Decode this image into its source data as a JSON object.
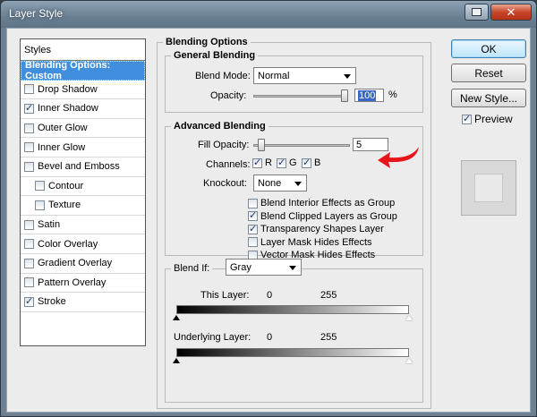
{
  "window": {
    "title": "Layer Style"
  },
  "styles_panel": {
    "header": "Styles",
    "items": [
      {
        "label": "Blending Options: Custom",
        "checkbox": false,
        "checked": false,
        "active": true,
        "indent": false
      },
      {
        "label": "Drop Shadow",
        "checkbox": true,
        "checked": false,
        "active": false,
        "indent": false
      },
      {
        "label": "Inner Shadow",
        "checkbox": true,
        "checked": true,
        "active": false,
        "indent": false
      },
      {
        "label": "Outer Glow",
        "checkbox": true,
        "checked": false,
        "active": false,
        "indent": false
      },
      {
        "label": "Inner Glow",
        "checkbox": true,
        "checked": false,
        "active": false,
        "indent": false
      },
      {
        "label": "Bevel and Emboss",
        "checkbox": true,
        "checked": false,
        "active": false,
        "indent": false
      },
      {
        "label": "Contour",
        "checkbox": true,
        "checked": false,
        "active": false,
        "indent": true
      },
      {
        "label": "Texture",
        "checkbox": true,
        "checked": false,
        "active": false,
        "indent": true
      },
      {
        "label": "Satin",
        "checkbox": true,
        "checked": false,
        "active": false,
        "indent": false
      },
      {
        "label": "Color Overlay",
        "checkbox": true,
        "checked": false,
        "active": false,
        "indent": false
      },
      {
        "label": "Gradient Overlay",
        "checkbox": true,
        "checked": false,
        "active": false,
        "indent": false
      },
      {
        "label": "Pattern Overlay",
        "checkbox": true,
        "checked": false,
        "active": false,
        "indent": false
      },
      {
        "label": "Stroke",
        "checkbox": true,
        "checked": true,
        "active": false,
        "indent": false
      }
    ]
  },
  "blending_options": {
    "title": "Blending Options",
    "general": {
      "title": "General Blending",
      "blend_mode_label": "Blend Mode:",
      "blend_mode_value": "Normal",
      "opacity_label": "Opacity:",
      "opacity_value": "100",
      "opacity_unit": "%",
      "opacity_level": 100
    },
    "advanced": {
      "title": "Advanced Blending",
      "fill_opacity_label": "Fill Opacity:",
      "fill_opacity_value": "5",
      "fill_opacity_level": 5,
      "channels_label": "Channels:",
      "channels": [
        {
          "label": "R",
          "checked": true
        },
        {
          "label": "G",
          "checked": true
        },
        {
          "label": "B",
          "checked": true
        }
      ],
      "knockout_label": "Knockout:",
      "knockout_value": "None",
      "options": [
        {
          "label": "Blend Interior Effects as Group",
          "checked": false
        },
        {
          "label": "Blend Clipped Layers as Group",
          "checked": true
        },
        {
          "label": "Transparency Shapes Layer",
          "checked": true
        },
        {
          "label": "Layer Mask Hides Effects",
          "checked": false
        },
        {
          "label": "Vector Mask Hides Effects",
          "checked": false
        }
      ]
    },
    "blend_if": {
      "label": "Blend If:",
      "value": "Gray",
      "this_layer_label": "This Layer:",
      "this_layer_min": "0",
      "this_layer_max": "255",
      "underlying_label": "Underlying Layer:",
      "underlying_min": "0",
      "underlying_max": "255"
    }
  },
  "buttons": {
    "ok": "OK",
    "reset": "Reset",
    "new_style": "New Style...",
    "preview_label": "Preview",
    "preview_checked": true
  },
  "colors": {
    "active_item": "#3f8fde",
    "annotation_arrow": "#e8141b"
  }
}
